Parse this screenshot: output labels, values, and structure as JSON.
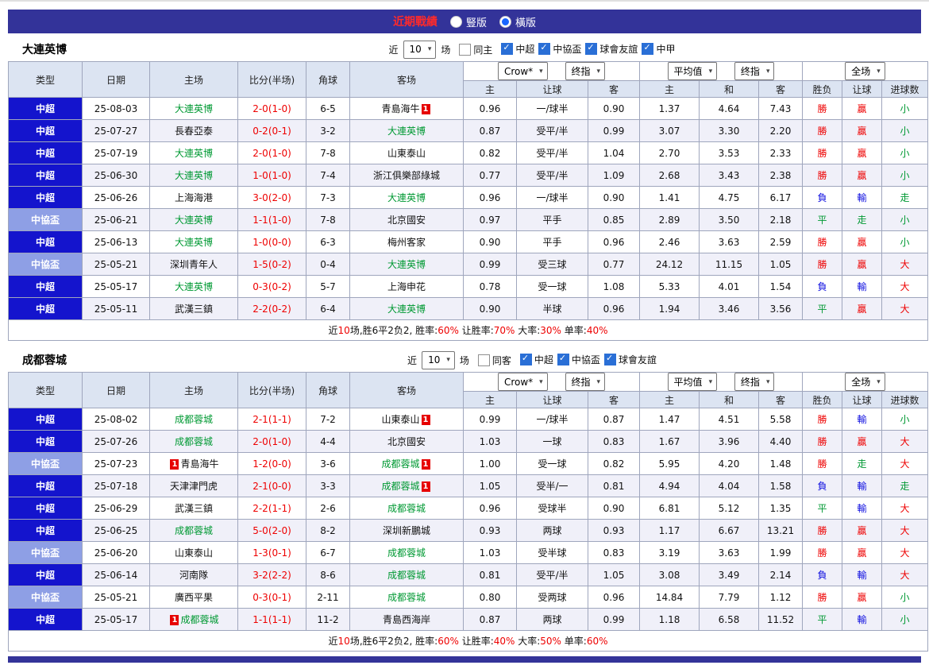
{
  "titlebar": {
    "title": "近期戰績",
    "layout_vertical": "豎版",
    "layout_horizontal": "橫版"
  },
  "labels": {
    "near": "近",
    "games": "场"
  },
  "columns": {
    "type": "类型",
    "date": "日期",
    "home": "主场",
    "score": "比分(半场)",
    "corner": "角球",
    "away": "客场",
    "odds_home": "主",
    "odds_handicap": "让球",
    "odds_away": "客",
    "avg_home": "主",
    "avg_draw": "和",
    "avg_away": "客",
    "result": "胜负",
    "handicap_result": "让球",
    "goals": "进球数"
  },
  "selects": {
    "odds_company": "Crow*",
    "odds_final": "终指",
    "avg": "平均值",
    "avg_final": "终指",
    "scope": "全场"
  },
  "misc": {
    "card_text": "1"
  },
  "colors": {
    "accent": "#333399",
    "csl_badge": "#1414cd",
    "cup_badge": "#8e9fe5",
    "win": "#ee0000",
    "lose": "#0f0fe0",
    "draw": "#009933",
    "header_bg": "#dce4f2"
  },
  "sections": [
    {
      "team": "大連英博",
      "controls": {
        "count": "10",
        "same_label": "同主",
        "same_checked": false,
        "leagues": [
          "中超",
          "中協盃",
          "球會友誼",
          "中甲"
        ]
      },
      "rows": [
        {
          "league": "中超",
          "lcls": "csl",
          "date": "25-08-03",
          "home": "大連英博",
          "home_hl": true,
          "home_badge": "",
          "score": "2-0(1-0)",
          "corner": "6-5",
          "away": "青島海牛",
          "away_hl": false,
          "away_badge": "after",
          "odds": [
            "0.96",
            "一/球半",
            "0.90"
          ],
          "avg": [
            "1.37",
            "4.64",
            "7.43"
          ],
          "res": [
            "勝",
            "r"
          ],
          "hres": [
            "贏",
            "r"
          ],
          "goal": [
            "小",
            "g"
          ]
        },
        {
          "league": "中超",
          "lcls": "csl",
          "date": "25-07-27",
          "home": "長春亞泰",
          "home_hl": false,
          "home_badge": "",
          "score": "0-2(0-1)",
          "corner": "3-2",
          "away": "大連英博",
          "away_hl": true,
          "away_badge": "",
          "odds": [
            "0.87",
            "受平/半",
            "0.99"
          ],
          "avg": [
            "3.07",
            "3.30",
            "2.20"
          ],
          "res": [
            "勝",
            "r"
          ],
          "hres": [
            "贏",
            "r"
          ],
          "goal": [
            "小",
            "g"
          ]
        },
        {
          "league": "中超",
          "lcls": "csl",
          "date": "25-07-19",
          "home": "大連英博",
          "home_hl": true,
          "home_badge": "",
          "score": "2-0(1-0)",
          "corner": "7-8",
          "away": "山東泰山",
          "away_hl": false,
          "away_badge": "",
          "odds": [
            "0.82",
            "受平/半",
            "1.04"
          ],
          "avg": [
            "2.70",
            "3.53",
            "2.33"
          ],
          "res": [
            "勝",
            "r"
          ],
          "hres": [
            "贏",
            "r"
          ],
          "goal": [
            "小",
            "g"
          ]
        },
        {
          "league": "中超",
          "lcls": "csl",
          "date": "25-06-30",
          "home": "大連英博",
          "home_hl": true,
          "home_badge": "",
          "score": "1-0(1-0)",
          "corner": "7-4",
          "away": "浙江俱樂部綠城",
          "away_hl": false,
          "away_badge": "",
          "odds": [
            "0.77",
            "受平/半",
            "1.09"
          ],
          "avg": [
            "2.68",
            "3.43",
            "2.38"
          ],
          "res": [
            "勝",
            "r"
          ],
          "hres": [
            "贏",
            "r"
          ],
          "goal": [
            "小",
            "g"
          ]
        },
        {
          "league": "中超",
          "lcls": "csl",
          "date": "25-06-26",
          "home": "上海海港",
          "home_hl": false,
          "home_badge": "",
          "score": "3-0(2-0)",
          "corner": "7-3",
          "away": "大連英博",
          "away_hl": true,
          "away_badge": "",
          "odds": [
            "0.96",
            "一/球半",
            "0.90"
          ],
          "avg": [
            "1.41",
            "4.75",
            "6.17"
          ],
          "res": [
            "負",
            "b"
          ],
          "hres": [
            "輸",
            "b"
          ],
          "goal": [
            "走",
            "g"
          ]
        },
        {
          "league": "中協盃",
          "lcls": "cup",
          "date": "25-06-21",
          "home": "大連英博",
          "home_hl": true,
          "home_badge": "",
          "score": "1-1(1-0)",
          "corner": "7-8",
          "away": "北京國安",
          "away_hl": false,
          "away_badge": "",
          "odds": [
            "0.97",
            "平手",
            "0.85"
          ],
          "avg": [
            "2.89",
            "3.50",
            "2.18"
          ],
          "res": [
            "平",
            "g"
          ],
          "hres": [
            "走",
            "g"
          ],
          "goal": [
            "小",
            "g"
          ]
        },
        {
          "league": "中超",
          "lcls": "csl",
          "date": "25-06-13",
          "home": "大連英博",
          "home_hl": true,
          "home_badge": "",
          "score": "1-0(0-0)",
          "corner": "6-3",
          "away": "梅州客家",
          "away_hl": false,
          "away_badge": "",
          "odds": [
            "0.90",
            "平手",
            "0.96"
          ],
          "avg": [
            "2.46",
            "3.63",
            "2.59"
          ],
          "res": [
            "勝",
            "r"
          ],
          "hres": [
            "贏",
            "r"
          ],
          "goal": [
            "小",
            "g"
          ]
        },
        {
          "league": "中協盃",
          "lcls": "cup",
          "date": "25-05-21",
          "home": "深圳青年人",
          "home_hl": false,
          "home_badge": "",
          "score": "1-5(0-2)",
          "corner": "0-4",
          "away": "大連英博",
          "away_hl": true,
          "away_badge": "",
          "odds": [
            "0.99",
            "受三球",
            "0.77"
          ],
          "avg": [
            "24.12",
            "11.15",
            "1.05"
          ],
          "res": [
            "勝",
            "r"
          ],
          "hres": [
            "贏",
            "r"
          ],
          "goal": [
            "大",
            "r"
          ]
        },
        {
          "league": "中超",
          "lcls": "csl",
          "date": "25-05-17",
          "home": "大連英博",
          "home_hl": true,
          "home_badge": "",
          "score": "0-3(0-2)",
          "corner": "5-7",
          "away": "上海申花",
          "away_hl": false,
          "away_badge": "",
          "odds": [
            "0.78",
            "受一球",
            "1.08"
          ],
          "avg": [
            "5.33",
            "4.01",
            "1.54"
          ],
          "res": [
            "負",
            "b"
          ],
          "hres": [
            "輸",
            "b"
          ],
          "goal": [
            "大",
            "r"
          ]
        },
        {
          "league": "中超",
          "lcls": "csl",
          "date": "25-05-11",
          "home": "武漢三鎮",
          "home_hl": false,
          "home_badge": "",
          "score": "2-2(0-2)",
          "corner": "6-4",
          "away": "大連英博",
          "away_hl": true,
          "away_badge": "",
          "odds": [
            "0.90",
            "半球",
            "0.96"
          ],
          "avg": [
            "1.94",
            "3.46",
            "3.56"
          ],
          "res": [
            "平",
            "g"
          ],
          "hres": [
            "贏",
            "r"
          ],
          "goal": [
            "大",
            "r"
          ]
        }
      ],
      "summary": [
        {
          "t": "近",
          "c": "k"
        },
        {
          "t": "10",
          "c": "r"
        },
        {
          "t": "场,胜6平2负2, 胜率:",
          "c": "k"
        },
        {
          "t": "60%",
          "c": "r"
        },
        {
          "t": " 让胜率:",
          "c": "k"
        },
        {
          "t": "70%",
          "c": "r"
        },
        {
          "t": " 大率:",
          "c": "k"
        },
        {
          "t": "30%",
          "c": "r"
        },
        {
          "t": " 单率:",
          "c": "k"
        },
        {
          "t": "40%",
          "c": "r"
        }
      ]
    },
    {
      "team": "成都蓉城",
      "controls": {
        "count": "10",
        "same_label": "同客",
        "same_checked": false,
        "leagues": [
          "中超",
          "中協盃",
          "球會友誼"
        ]
      },
      "rows": [
        {
          "league": "中超",
          "lcls": "csl",
          "date": "25-08-02",
          "home": "成都蓉城",
          "home_hl": true,
          "home_badge": "",
          "score": "2-1(1-1)",
          "corner": "7-2",
          "away": "山東泰山",
          "away_hl": false,
          "away_badge": "after",
          "odds": [
            "0.99",
            "一/球半",
            "0.87"
          ],
          "avg": [
            "1.47",
            "4.51",
            "5.58"
          ],
          "res": [
            "勝",
            "r"
          ],
          "hres": [
            "輸",
            "b"
          ],
          "goal": [
            "小",
            "g"
          ]
        },
        {
          "league": "中超",
          "lcls": "csl",
          "date": "25-07-26",
          "home": "成都蓉城",
          "home_hl": true,
          "home_badge": "",
          "score": "2-0(1-0)",
          "corner": "4-4",
          "away": "北京國安",
          "away_hl": false,
          "away_badge": "",
          "odds": [
            "1.03",
            "一球",
            "0.83"
          ],
          "avg": [
            "1.67",
            "3.96",
            "4.40"
          ],
          "res": [
            "勝",
            "r"
          ],
          "hres": [
            "贏",
            "r"
          ],
          "goal": [
            "大",
            "r"
          ]
        },
        {
          "league": "中協盃",
          "lcls": "cup",
          "date": "25-07-23",
          "home": "青島海牛",
          "home_hl": false,
          "home_badge": "before",
          "score": "1-2(0-0)",
          "corner": "3-6",
          "away": "成都蓉城",
          "away_hl": true,
          "away_badge": "after",
          "odds": [
            "1.00",
            "受一球",
            "0.82"
          ],
          "avg": [
            "5.95",
            "4.20",
            "1.48"
          ],
          "res": [
            "勝",
            "r"
          ],
          "hres": [
            "走",
            "g"
          ],
          "goal": [
            "大",
            "r"
          ]
        },
        {
          "league": "中超",
          "lcls": "csl",
          "date": "25-07-18",
          "home": "天津津門虎",
          "home_hl": false,
          "home_badge": "",
          "score": "2-1(0-0)",
          "corner": "3-3",
          "away": "成都蓉城",
          "away_hl": true,
          "away_badge": "after",
          "odds": [
            "1.05",
            "受半/一",
            "0.81"
          ],
          "avg": [
            "4.94",
            "4.04",
            "1.58"
          ],
          "res": [
            "負",
            "b"
          ],
          "hres": [
            "輸",
            "b"
          ],
          "goal": [
            "走",
            "g"
          ]
        },
        {
          "league": "中超",
          "lcls": "csl",
          "date": "25-06-29",
          "home": "武漢三鎮",
          "home_hl": false,
          "home_badge": "",
          "score": "2-2(1-1)",
          "corner": "2-6",
          "away": "成都蓉城",
          "away_hl": true,
          "away_badge": "",
          "odds": [
            "0.96",
            "受球半",
            "0.90"
          ],
          "avg": [
            "6.81",
            "5.12",
            "1.35"
          ],
          "res": [
            "平",
            "g"
          ],
          "hres": [
            "輸",
            "b"
          ],
          "goal": [
            "大",
            "r"
          ]
        },
        {
          "league": "中超",
          "lcls": "csl",
          "date": "25-06-25",
          "home": "成都蓉城",
          "home_hl": true,
          "home_badge": "",
          "score": "5-0(2-0)",
          "corner": "8-2",
          "away": "深圳新鵬城",
          "away_hl": false,
          "away_badge": "",
          "odds": [
            "0.93",
            "两球",
            "0.93"
          ],
          "avg": [
            "1.17",
            "6.67",
            "13.21"
          ],
          "res": [
            "勝",
            "r"
          ],
          "hres": [
            "贏",
            "r"
          ],
          "goal": [
            "大",
            "r"
          ]
        },
        {
          "league": "中協盃",
          "lcls": "cup",
          "date": "25-06-20",
          "home": "山東泰山",
          "home_hl": false,
          "home_badge": "",
          "score": "1-3(0-1)",
          "corner": "6-7",
          "away": "成都蓉城",
          "away_hl": true,
          "away_badge": "",
          "odds": [
            "1.03",
            "受半球",
            "0.83"
          ],
          "avg": [
            "3.19",
            "3.63",
            "1.99"
          ],
          "res": [
            "勝",
            "r"
          ],
          "hres": [
            "贏",
            "r"
          ],
          "goal": [
            "大",
            "r"
          ]
        },
        {
          "league": "中超",
          "lcls": "csl",
          "date": "25-06-14",
          "home": "河南隊",
          "home_hl": false,
          "home_badge": "",
          "score": "3-2(2-2)",
          "corner": "8-6",
          "away": "成都蓉城",
          "away_hl": true,
          "away_badge": "",
          "odds": [
            "0.81",
            "受平/半",
            "1.05"
          ],
          "avg": [
            "3.08",
            "3.49",
            "2.14"
          ],
          "res": [
            "負",
            "b"
          ],
          "hres": [
            "輸",
            "b"
          ],
          "goal": [
            "大",
            "r"
          ]
        },
        {
          "league": "中協盃",
          "lcls": "cup",
          "date": "25-05-21",
          "home": "廣西平果",
          "home_hl": false,
          "home_badge": "",
          "score": "0-3(0-1)",
          "corner": "2-11",
          "away": "成都蓉城",
          "away_hl": true,
          "away_badge": "",
          "odds": [
            "0.80",
            "受两球",
            "0.96"
          ],
          "avg": [
            "14.84",
            "7.79",
            "1.12"
          ],
          "res": [
            "勝",
            "r"
          ],
          "hres": [
            "贏",
            "r"
          ],
          "goal": [
            "小",
            "g"
          ]
        },
        {
          "league": "中超",
          "lcls": "csl",
          "date": "25-05-17",
          "home": "成都蓉城",
          "home_hl": true,
          "home_badge": "before",
          "score": "1-1(1-1)",
          "corner": "11-2",
          "away": "青島西海岸",
          "away_hl": false,
          "away_badge": "",
          "odds": [
            "0.87",
            "两球",
            "0.99"
          ],
          "avg": [
            "1.18",
            "6.58",
            "11.52"
          ],
          "res": [
            "平",
            "g"
          ],
          "hres": [
            "輸",
            "b"
          ],
          "goal": [
            "小",
            "g"
          ]
        }
      ],
      "summary": [
        {
          "t": "近",
          "c": "k"
        },
        {
          "t": "10",
          "c": "r"
        },
        {
          "t": "场,胜6平2负2, 胜率:",
          "c": "k"
        },
        {
          "t": "60%",
          "c": "r"
        },
        {
          "t": " 让胜率:",
          "c": "k"
        },
        {
          "t": "40%",
          "c": "r"
        },
        {
          "t": " 大率:",
          "c": "k"
        },
        {
          "t": "50%",
          "c": "r"
        },
        {
          "t": " 单率:",
          "c": "k"
        },
        {
          "t": "60%",
          "c": "r"
        }
      ]
    }
  ]
}
